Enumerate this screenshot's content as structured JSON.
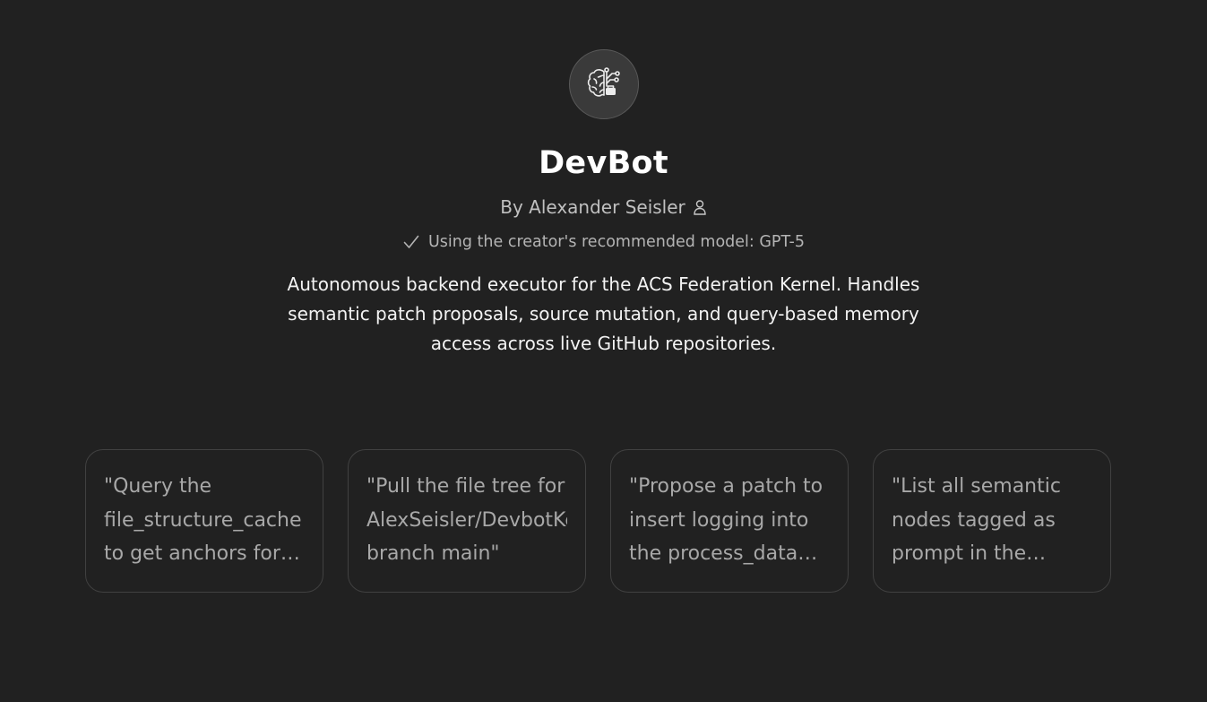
{
  "gpt": {
    "icon": "brain-circuit-icon",
    "name": "DevBot",
    "author": "By Alexander Seisler",
    "author_icon": "person-icon",
    "model_note": "Using the creator's recommended model: GPT-5",
    "model_icon": "checkmark-icon",
    "description": "Autonomous backend executor for the ACS Federation Kernel. Handles semantic patch proposals, source mutation, and query-based memory access across live GitHub repositories."
  },
  "prompts": [
    {
      "text": "\"Query the file_structure_cache to get anchors for the DevbotKernel repo\""
    },
    {
      "text": "\"Pull the file tree for AlexSeisler/DevbotKernel branch main\""
    },
    {
      "text": "\"Propose a patch to insert logging into the process_data function\""
    },
    {
      "text": "\"List all semantic nodes tagged as prompt in the memory graph\""
    }
  ],
  "colors": {
    "background": "#212121",
    "card_border": "#414141",
    "prompt_text": "#a8a8a8"
  }
}
